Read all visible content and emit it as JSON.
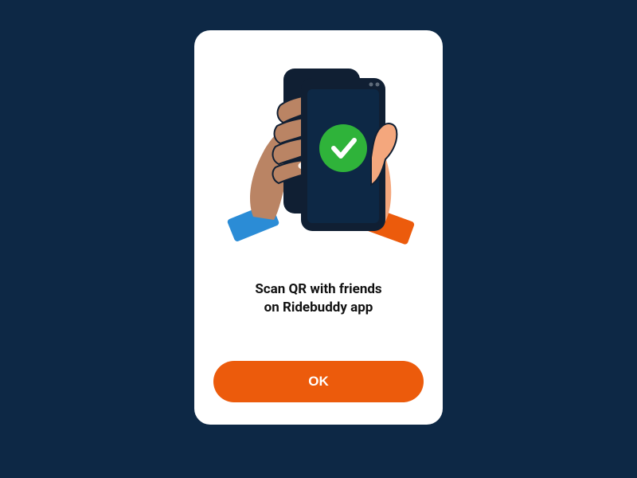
{
  "modal": {
    "message": "Scan QR with friends\non Ridebuddy app",
    "ok_label": "OK"
  },
  "colors": {
    "background": "#0d2845",
    "card": "#ffffff",
    "accent": "#ec5b0c",
    "phone_body": "#101f33",
    "phone_screen": "#0d2845",
    "success_circle": "#2fb33a",
    "hand_left_skin": "#ba8464",
    "hand_right_skin": "#f4a77d",
    "cuff_left": "#2b8cd6",
    "cuff_right": "#ec5b0c",
    "nail": "#fff5ee"
  },
  "illustration": {
    "description": "Two hands holding smartphones showing a green check mark",
    "icon": "checkmark-icon"
  }
}
